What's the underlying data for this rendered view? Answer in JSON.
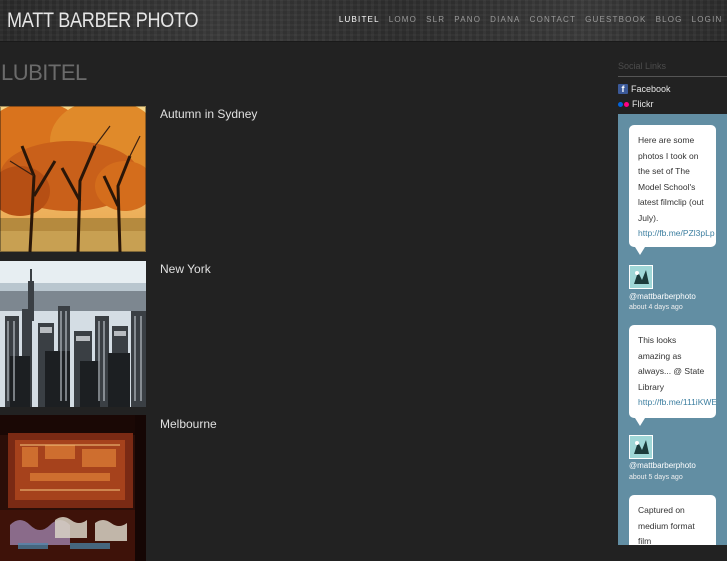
{
  "site": {
    "logo": "MATT BARBER PHOTO"
  },
  "nav": [
    {
      "label": "LUBITEL",
      "active": true
    },
    {
      "label": "LOMO",
      "active": false
    },
    {
      "label": "SLR",
      "active": false
    },
    {
      "label": "PANO",
      "active": false
    },
    {
      "label": "DIANA",
      "active": false
    },
    {
      "label": "CONTACT",
      "active": false
    },
    {
      "label": "GUESTBOOK",
      "active": false
    },
    {
      "label": "BLOG",
      "active": false
    },
    {
      "label": "LOGIN",
      "active": false
    }
  ],
  "main": {
    "title": "LUBITEL",
    "posts": [
      {
        "title": "Autumn in Sydney",
        "image": "autumn-trees-photo"
      },
      {
        "title": "New York",
        "image": "new-york-skyline-photo"
      },
      {
        "title": "Melbourne",
        "image": "melbourne-graffiti-photo"
      }
    ]
  },
  "sidebar": {
    "heading": "Social Links",
    "links": [
      {
        "label": "Facebook",
        "icon": "facebook-icon"
      },
      {
        "label": "Flickr",
        "icon": "flickr-icon"
      }
    ],
    "tweets": [
      {
        "lines": [
          "Here are some",
          "photos I took on",
          "the set of The",
          "Model School's",
          "latest filmclip (out",
          "July)."
        ],
        "link": "http://fb.me/PZl3pLp",
        "user": "@mattbarberphoto",
        "time": "about 4 days ago"
      },
      {
        "lines": [
          "This looks",
          "amazing as",
          "always... @ State",
          "Library"
        ],
        "link": "http://fb.me/111iKWE",
        "user": "@mattbarberphoto",
        "time": "about 5 days ago"
      },
      {
        "lines": [
          "Captured on",
          "medium format",
          "film"
        ],
        "link": "",
        "user": "",
        "time": ""
      }
    ]
  },
  "colors": {
    "background": "#222222",
    "active_nav": "#ffffff",
    "twitter_panel": "#628ea3",
    "facebook": "#3b5998",
    "flickr_blue": "#0063dc",
    "flickr_pink": "#ff0084"
  }
}
